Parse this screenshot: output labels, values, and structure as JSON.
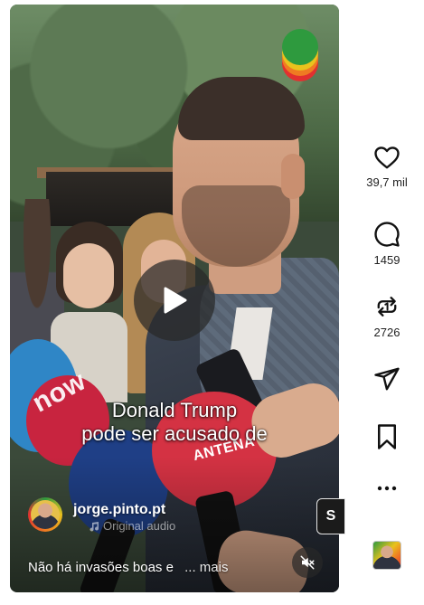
{
  "video": {
    "caption_line1": "Donald Trump",
    "caption_line2": "pode ser acusado de",
    "mic_brand_1": "now",
    "mic_brand_2": "ANTENA",
    "side_chip_text": "S"
  },
  "author": {
    "username": "jorge.pinto.pt",
    "audio": "Original audio"
  },
  "post": {
    "description": "Não há invasões boas e",
    "more_label": "... mais"
  },
  "actions": {
    "like_count": "39,7 mil",
    "comment_count": "1459",
    "repost_count": "2726"
  },
  "colors": {
    "rainbow": [
      "#2e9a3e",
      "#e9c21d",
      "#ef7b22",
      "#e2302f"
    ]
  },
  "icons": {
    "play": "play-icon",
    "mute": "mute-icon",
    "like": "heart-icon",
    "comment": "comment-icon",
    "repost": "repost-icon",
    "share": "share-icon",
    "save": "bookmark-icon",
    "more": "more-icon"
  }
}
